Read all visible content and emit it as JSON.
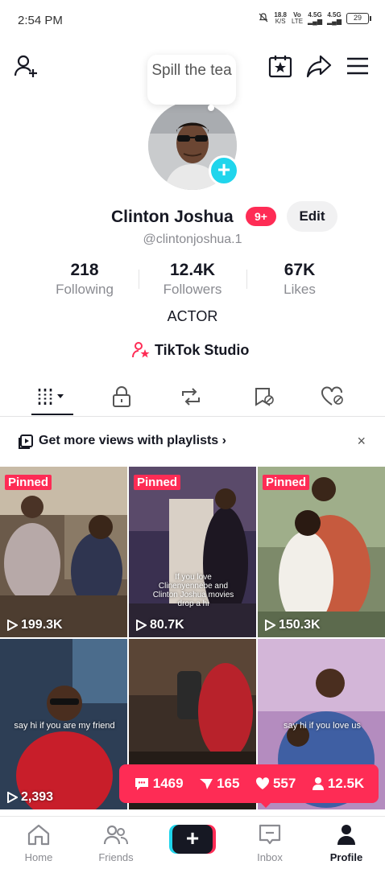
{
  "status_bar": {
    "time": "2:54 PM",
    "net_speed": "18.8",
    "net_unit": "K/S",
    "volte": "Vo",
    "lte": "LTE",
    "signal1": "4.5G",
    "signal2": "4.5G",
    "battery": "29"
  },
  "tooltip": {
    "text": "Spill the tea"
  },
  "profile": {
    "name": "Clinton Joshua",
    "badge": "9+",
    "edit_label": "Edit",
    "handle": "@clintonjoshua.1",
    "bio": "ACTOR",
    "studio_label": "TikTok Studio"
  },
  "stats": [
    {
      "value": "218",
      "label": "Following"
    },
    {
      "value": "12.4K",
      "label": "Followers"
    },
    {
      "value": "67K",
      "label": "Likes"
    }
  ],
  "promo": {
    "text": "Get more views with playlists",
    "chevron": "›",
    "close": "×"
  },
  "videos": [
    {
      "pinned": "Pinned",
      "views": "199.3K",
      "caption": ""
    },
    {
      "pinned": "Pinned",
      "views": "80.7K",
      "caption": "If you love Clinenyennebe and Clinton Joshua movies drop a hi"
    },
    {
      "pinned": "Pinned",
      "views": "150.3K",
      "caption": ""
    },
    {
      "pinned": "",
      "views": "2,393",
      "caption": "say hi if you are my friend"
    },
    {
      "pinned": "",
      "views": "",
      "caption": ""
    },
    {
      "pinned": "",
      "views": "",
      "caption": "say hi if you love us"
    }
  ],
  "overlay_stats": {
    "comments": "1469",
    "shares": "165",
    "likes": "557",
    "followers": "12.5K"
  },
  "bottom_nav": {
    "home": "Home",
    "friends": "Friends",
    "create": "+",
    "inbox": "Inbox",
    "profile": "Profile"
  },
  "colors": {
    "accent": "#fe2c55",
    "cyan": "#20d5ec",
    "text": "#161823",
    "muted": "#8a8b91"
  }
}
